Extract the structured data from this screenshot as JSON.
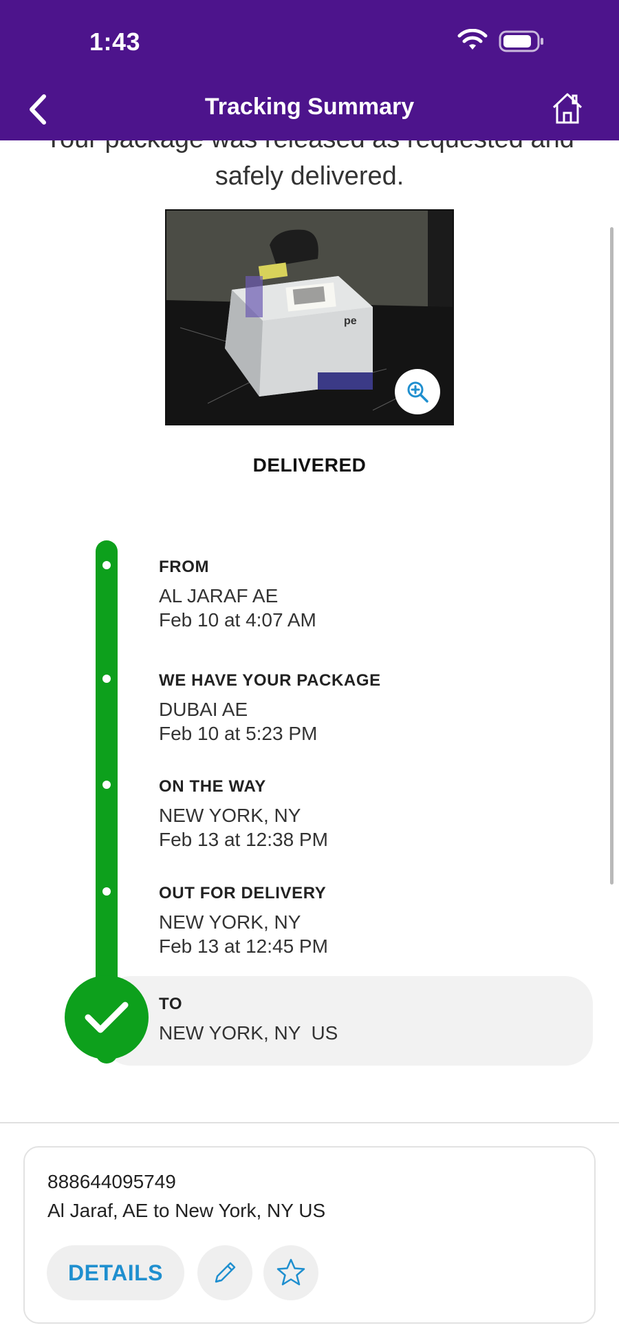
{
  "status_bar": {
    "time": "1:43"
  },
  "header": {
    "title": "Tracking Summary",
    "back_icon": "chevron-left-icon",
    "home_icon": "home-icon"
  },
  "message": {
    "text": "Your package was released as requested and safely delivered."
  },
  "photo": {
    "zoom_icon": "zoom-in-icon"
  },
  "status_label": "DELIVERED",
  "timeline": {
    "color": "#0da01c",
    "events": [
      {
        "label": "FROM",
        "location": "AL JARAF AE",
        "time": "Feb 10 at 4:07 AM"
      },
      {
        "label": "WE HAVE YOUR PACKAGE",
        "location": "DUBAI AE",
        "time": "Feb 10 at 5:23 PM"
      },
      {
        "label": "ON THE WAY",
        "location": "NEW YORK, NY",
        "time": "Feb 13 at 12:38 PM"
      },
      {
        "label": "OUT FOR DELIVERY",
        "location": "NEW YORK, NY",
        "time": "Feb 13 at 12:45 PM"
      }
    ],
    "destination": {
      "label": "TO",
      "location": "NEW YORK, NY  US"
    }
  },
  "card": {
    "tracking_number": "888644095749",
    "route": "Al Jaraf, AE to New York, NY US",
    "details_label": "DETAILS",
    "edit_icon": "pencil-icon",
    "favorite_icon": "star-icon"
  },
  "colors": {
    "header": "#4d148c",
    "accent_blue": "#1f8fcf",
    "success_green": "#0da01c"
  }
}
